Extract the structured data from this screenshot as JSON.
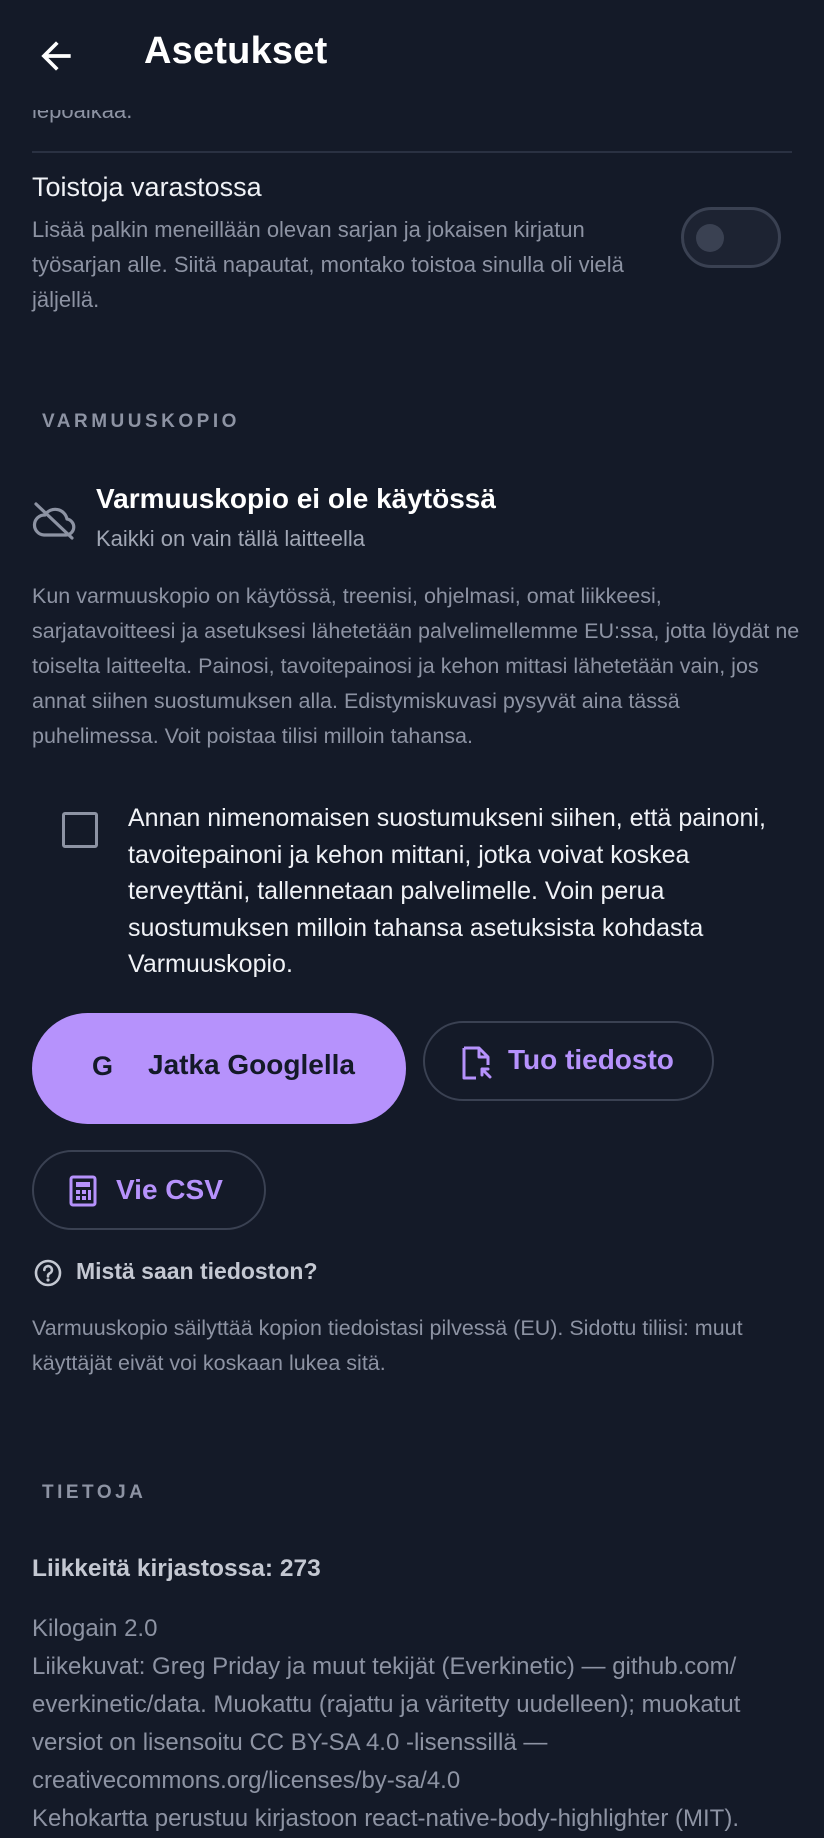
{
  "header": {
    "title": "Asetukset",
    "back_icon": "arrow-left-icon"
  },
  "clipped_text": "lepoaikaa.",
  "sets_in_stock": {
    "title": "Toistoja varastossa",
    "description": "Lisää palkin meneillään olevan sarjan ja jokaisen kirjatun työsarjan alle. Siitä napautat, montako toistoa sinulla oli vielä jäljellä.",
    "toggle_on": false
  },
  "backup": {
    "section_label": "VARMUUSKOPIO",
    "status_icon": "cloud-off-icon",
    "status_title": "Varmuuskopio ei ole käytössä",
    "status_subtitle": "Kaikki on vain tällä laitteella",
    "description": "Kun varmuuskopio on käytössä, treenisi, ohjelmasi, omat liikkeesi, sarjatavoitteesi ja asetuksesi lähetetään palvelimellemme EU:ssa, jotta löydät ne toiselta laitteelta. Painosi, tavoitepainosi ja kehon mittasi lähetetään vain, jos annat siihen suostumuksen alla. Edistymiskuvasi pysyvät aina tässä puhelimessa. Voit poistaa tilisi milloin tahansa.",
    "consent_checked": false,
    "consent_text": "Annan nimenomaisen suostumukseni siihen, että painoni, tavoitepainoni ja kehon mittani, jotka voivat koskea terveyttäni, tallennetaan palvelimelle. Voin perua suostumuksen milloin tahansa asetuksista kohdasta Varmuuskopio.",
    "google_button": {
      "glyph": "G",
      "label": "Jatka Googlella"
    },
    "import_button": {
      "icon": "file-import-icon",
      "label": "Tuo tiedosto"
    },
    "export_button": {
      "icon": "spreadsheet-icon",
      "label": "Vie CSV"
    },
    "help_link": {
      "icon": "help-circle-icon",
      "label": "Mistä saan tiedoston?"
    },
    "footer_note": "Varmuuskopio säilyttää kopion tiedoistasi pilvessä (EU). Sidottu tiliisi: muut käyttäjät eivät voi koskaan lukea sitä."
  },
  "info": {
    "section_label": "TIETOJA",
    "library_count": "Liikkeitä kirjastossa: 273",
    "app_version": "Kilogain 2.0",
    "image_credits": "Liikekuvat: Greg Priday ja muut tekijät (Everkinetic) — github.com/ everkinetic/data. Muokattu (rajattu ja väritetty uudelleen); muokatut versiot on lisensoitu CC BY-SA 4.0 -lisenssillä — creativecommons.org/licenses/by-sa/4.0",
    "body_map_credit": "Kehokartta perustuu kirjastoon react-native-body-highlighter (MIT)."
  },
  "colors": {
    "background": "#141a28",
    "accent": "#b692fc",
    "muted_text": "#8d93a3"
  }
}
